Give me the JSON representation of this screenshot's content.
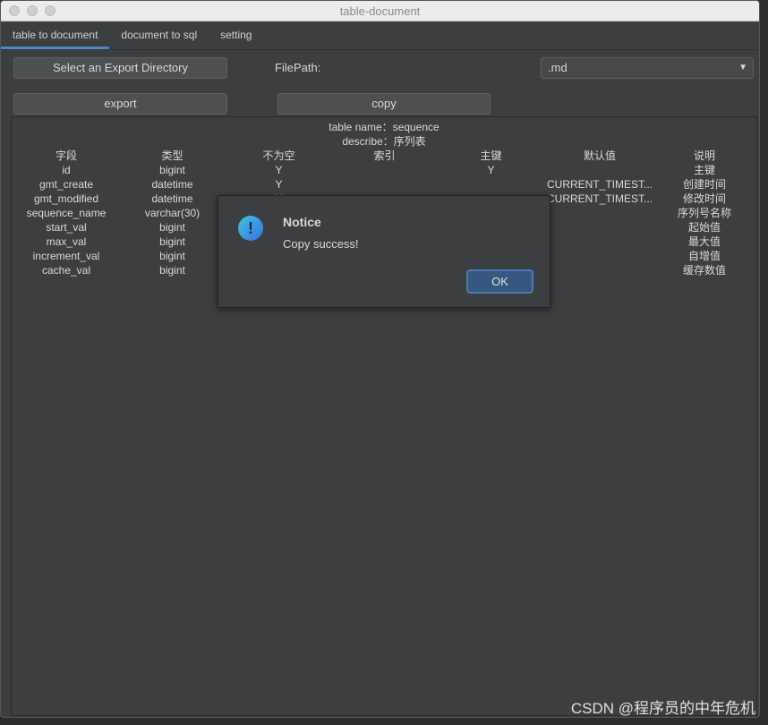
{
  "window": {
    "title": "table-document"
  },
  "tabs": [
    {
      "label": "table to document"
    },
    {
      "label": "document to sql"
    },
    {
      "label": "setting"
    }
  ],
  "toolbar": {
    "select_dir_label": "Select an Export Directory",
    "filepath_label": "FilePath:",
    "format_value": ".md",
    "export_label": "export",
    "copy_label": "copy"
  },
  "doc": {
    "table_name": "table name：sequence",
    "describe": "describe：序列表",
    "headers": [
      "字段",
      "类型",
      "不为空",
      "索引",
      "主键",
      "默认值",
      "说明"
    ],
    "rows": [
      [
        "id",
        "bigint",
        "Y",
        "",
        "Y",
        "",
        "主键"
      ],
      [
        "gmt_create",
        "datetime",
        "Y",
        "",
        "",
        "CURRENT_TIMEST...",
        "创建时间"
      ],
      [
        "gmt_modified",
        "datetime",
        "Y",
        "",
        "",
        "CURRENT_TIMEST...",
        "修改时间"
      ],
      [
        "sequence_name",
        "varchar(30)",
        "",
        "",
        "",
        "",
        "序列号名称"
      ],
      [
        "start_val",
        "bigint",
        "",
        "",
        "",
        "",
        "起始值"
      ],
      [
        "max_val",
        "bigint",
        "",
        "",
        "",
        "",
        "最大值"
      ],
      [
        "increment_val",
        "bigint",
        "",
        "",
        "",
        "",
        "自增值"
      ],
      [
        "cache_val",
        "bigint",
        "",
        "",
        "",
        "",
        "缓存数值"
      ]
    ]
  },
  "dialog": {
    "title": "Notice",
    "message": "Copy success!",
    "ok_label": "OK",
    "icon": "exclamation-icon",
    "accent": "#365880"
  },
  "watermark": "CSDN @程序员的中年危机"
}
